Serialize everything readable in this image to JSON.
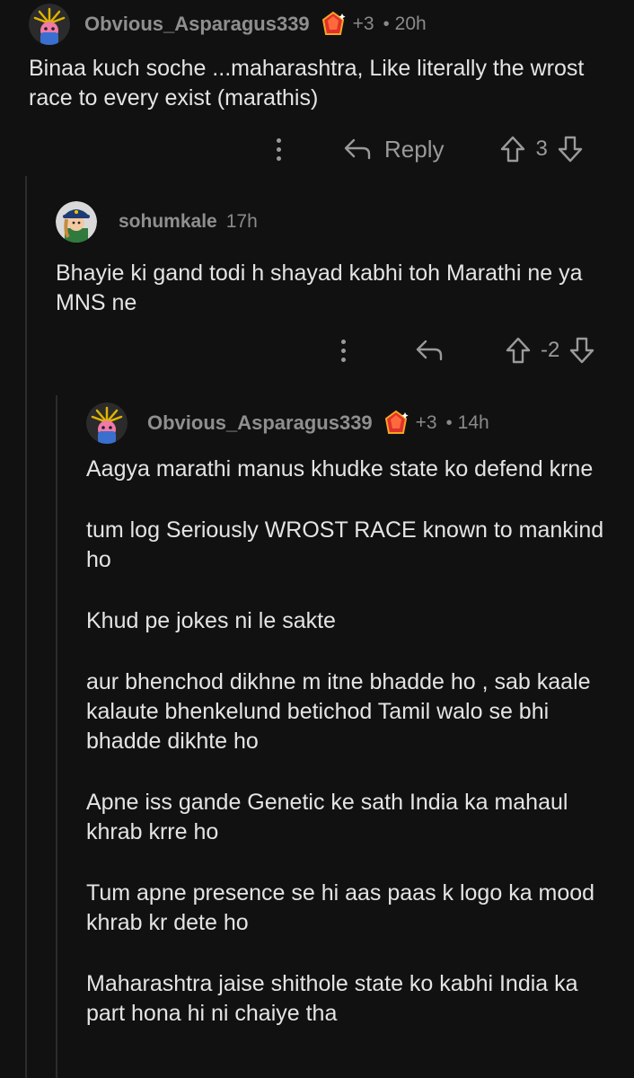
{
  "comments": [
    {
      "username": "Obvious_Asparagus339",
      "karma": "+3",
      "separator": "•",
      "time": "20h",
      "body": [
        "Binaa kuch soche ...maharashtra, Like literally the wrost race to every exist (marathis)"
      ],
      "actions": {
        "reply_label": "Reply",
        "score": "3"
      }
    },
    {
      "username": "sohumkale",
      "time": "17h",
      "body": [
        "Bhayie ki gand todi h shayad kabhi toh Marathi ne ya MNS ne"
      ],
      "actions": {
        "score": "-2"
      }
    },
    {
      "username": "Obvious_Asparagus339",
      "karma": "+3",
      "separator": "•",
      "time": "14h",
      "body": [
        "Aagya marathi manus khudke state ko defend krne",
        "tum log Seriously WROST RACE known to mankind ho",
        "Khud pe jokes ni le sakte",
        "aur bhenchod dikhne m itne bhadde ho , sab kaale kalaute bhenkelund betichod Tamil walo se bhi bhadde dikhte ho",
        "Apne iss gande Genetic ke sath India ka mahaul khrab krre ho",
        "Tum apne presence se hi aas paas k logo ka mood khrab kr dete ho",
        "Maharashtra jaise shithole state ko kabhi India ka part hona hi ni chaiye tha"
      ]
    }
  ],
  "icons": {
    "avatar1": "asparagus-avatar-icon",
    "flair": "red-gem-flair-icon",
    "avatar2": "captain-avatar-icon",
    "more": "more-options-icon",
    "reply": "reply-arrow-icon",
    "upvote": "upvote-arrow-icon",
    "downvote": "downvote-arrow-icon"
  },
  "colors": {
    "background": "#111111",
    "text": "#e4e4e4",
    "meta": "#8a8a8a",
    "thread_line": "#2c2c2c"
  }
}
